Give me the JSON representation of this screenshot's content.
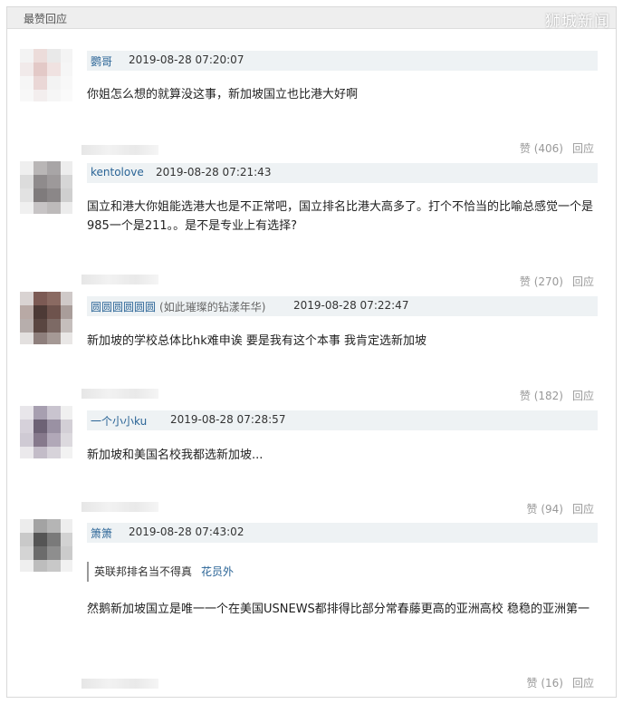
{
  "header": {
    "title": "最赞回应",
    "watermark": "狮城新闻"
  },
  "comments": [
    {
      "user": "鹦哥",
      "user_sub": "",
      "time": "2019-08-28 07:20:07",
      "text": "你姐怎么想的就算没这事，新加坡国立也比港大好啊",
      "like_label": "赞",
      "like_count": "(406)",
      "reply_label": "回应"
    },
    {
      "user": "kentolove",
      "user_sub": "",
      "time": "2019-08-28 07:21:43",
      "text": "国立和港大你姐能选港大也是不正常吧，国立排名比港大高多了。打个不恰当的比喻总感觉一个是985一个是211。。是不是专业上有选择?",
      "like_label": "赞",
      "like_count": "(270)",
      "reply_label": "回应"
    },
    {
      "user": "圆圆圆圆圆圆",
      "user_sub": "(如此璀璨的钻漾年华)",
      "time": "2019-08-28 07:22:47",
      "text": "新加坡的学校总体比hk难申诶 要是我有这个本事 我肯定选新加坡",
      "like_label": "赞",
      "like_count": "(182)",
      "reply_label": "回应"
    },
    {
      "user": "一个小小ku",
      "user_sub": "",
      "time": "2019-08-28 07:28:57",
      "text": "新加坡和美国名校我都选新加坡...",
      "like_label": "赞",
      "like_count": "(94)",
      "reply_label": "回应"
    },
    {
      "user": "箫箫",
      "user_sub": "",
      "time": "2019-08-28 07:43:02",
      "quote_text": "英联邦排名当不得真",
      "quote_author": "花员外",
      "text": "然鹅新加坡国立是唯一一个在美国USNEWS都排得比部分常春藤更高的亚洲高校 稳稳的亚洲第一",
      "like_label": "赞",
      "like_count": "(16)",
      "reply_label": "回应"
    }
  ]
}
